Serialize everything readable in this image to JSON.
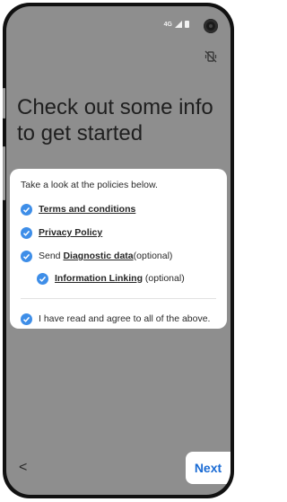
{
  "status_bar": {
    "network_label": "4G",
    "signal_icon": "signal-icon",
    "battery_icon": "battery-icon"
  },
  "header": {
    "mute_icon": "vibrate-mute-icon",
    "title": "Check out some info to get started"
  },
  "card": {
    "intro": "Take a look at the policies below.",
    "items": [
      {
        "checked": true,
        "link": "Terms and conditions",
        "prefix": "",
        "suffix": ""
      },
      {
        "checked": true,
        "link": "Privacy Policy",
        "prefix": "",
        "suffix": ""
      },
      {
        "checked": true,
        "prefix": "Send ",
        "link": "Diagnostic data",
        "suffix": "(optional)"
      },
      {
        "checked": true,
        "prefix": "",
        "link": "Information Linking",
        "suffix": " (optional)"
      }
    ],
    "agree_all": {
      "checked": true,
      "label": "I have read and agree to all of the above."
    }
  },
  "footer": {
    "back_label": "<",
    "next_label": "Next"
  },
  "colors": {
    "screen_background": "#8e8e8e",
    "check_blue": "#3e8ee8",
    "next_blue": "#1a6bd4"
  }
}
